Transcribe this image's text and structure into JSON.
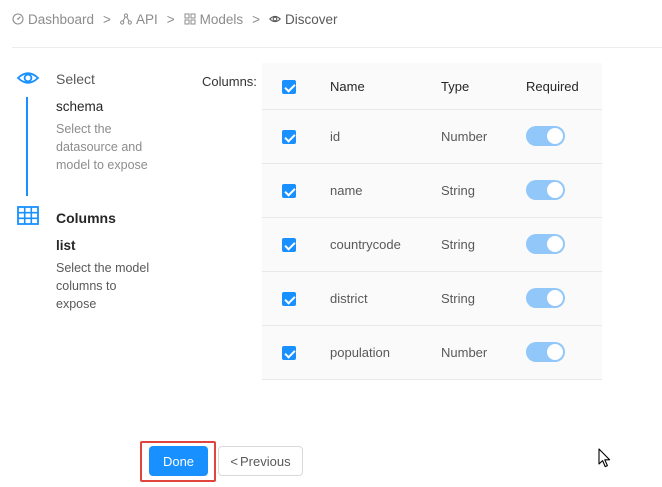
{
  "breadcrumb": [
    {
      "label": "Dashboard",
      "icon": "dashboard-icon"
    },
    {
      "label": "API",
      "icon": "api-icon"
    },
    {
      "label": "Models",
      "icon": "models-icon"
    },
    {
      "label": "Discover",
      "icon": "eye-icon"
    }
  ],
  "breadcrumb_separator": ">",
  "steps": [
    {
      "title": "Select",
      "subtitle": "schema",
      "description": "Select the datasource and model to expose",
      "icon": "eye-icon",
      "status": "done"
    },
    {
      "title": "Columns",
      "subtitle": "list",
      "description": "Select the model columns to expose",
      "icon": "table-icon",
      "status": "active"
    }
  ],
  "columns_label": "Columns:",
  "table": {
    "headers": {
      "name": "Name",
      "type": "Type",
      "required": "Required"
    },
    "rows": [
      {
        "name": "id",
        "type": "Number",
        "selected": true,
        "required": true
      },
      {
        "name": "name",
        "type": "String",
        "selected": true,
        "required": true
      },
      {
        "name": "countrycode",
        "type": "String",
        "selected": true,
        "required": true
      },
      {
        "name": "district",
        "type": "String",
        "selected": true,
        "required": true
      },
      {
        "name": "population",
        "type": "Number",
        "selected": true,
        "required": true
      }
    ]
  },
  "buttons": {
    "done": "Done",
    "previous": "Previous"
  },
  "colors": {
    "primary": "#1890ff",
    "toggle_disabled_on": "#91c7f9",
    "highlight": "#e0443c"
  }
}
